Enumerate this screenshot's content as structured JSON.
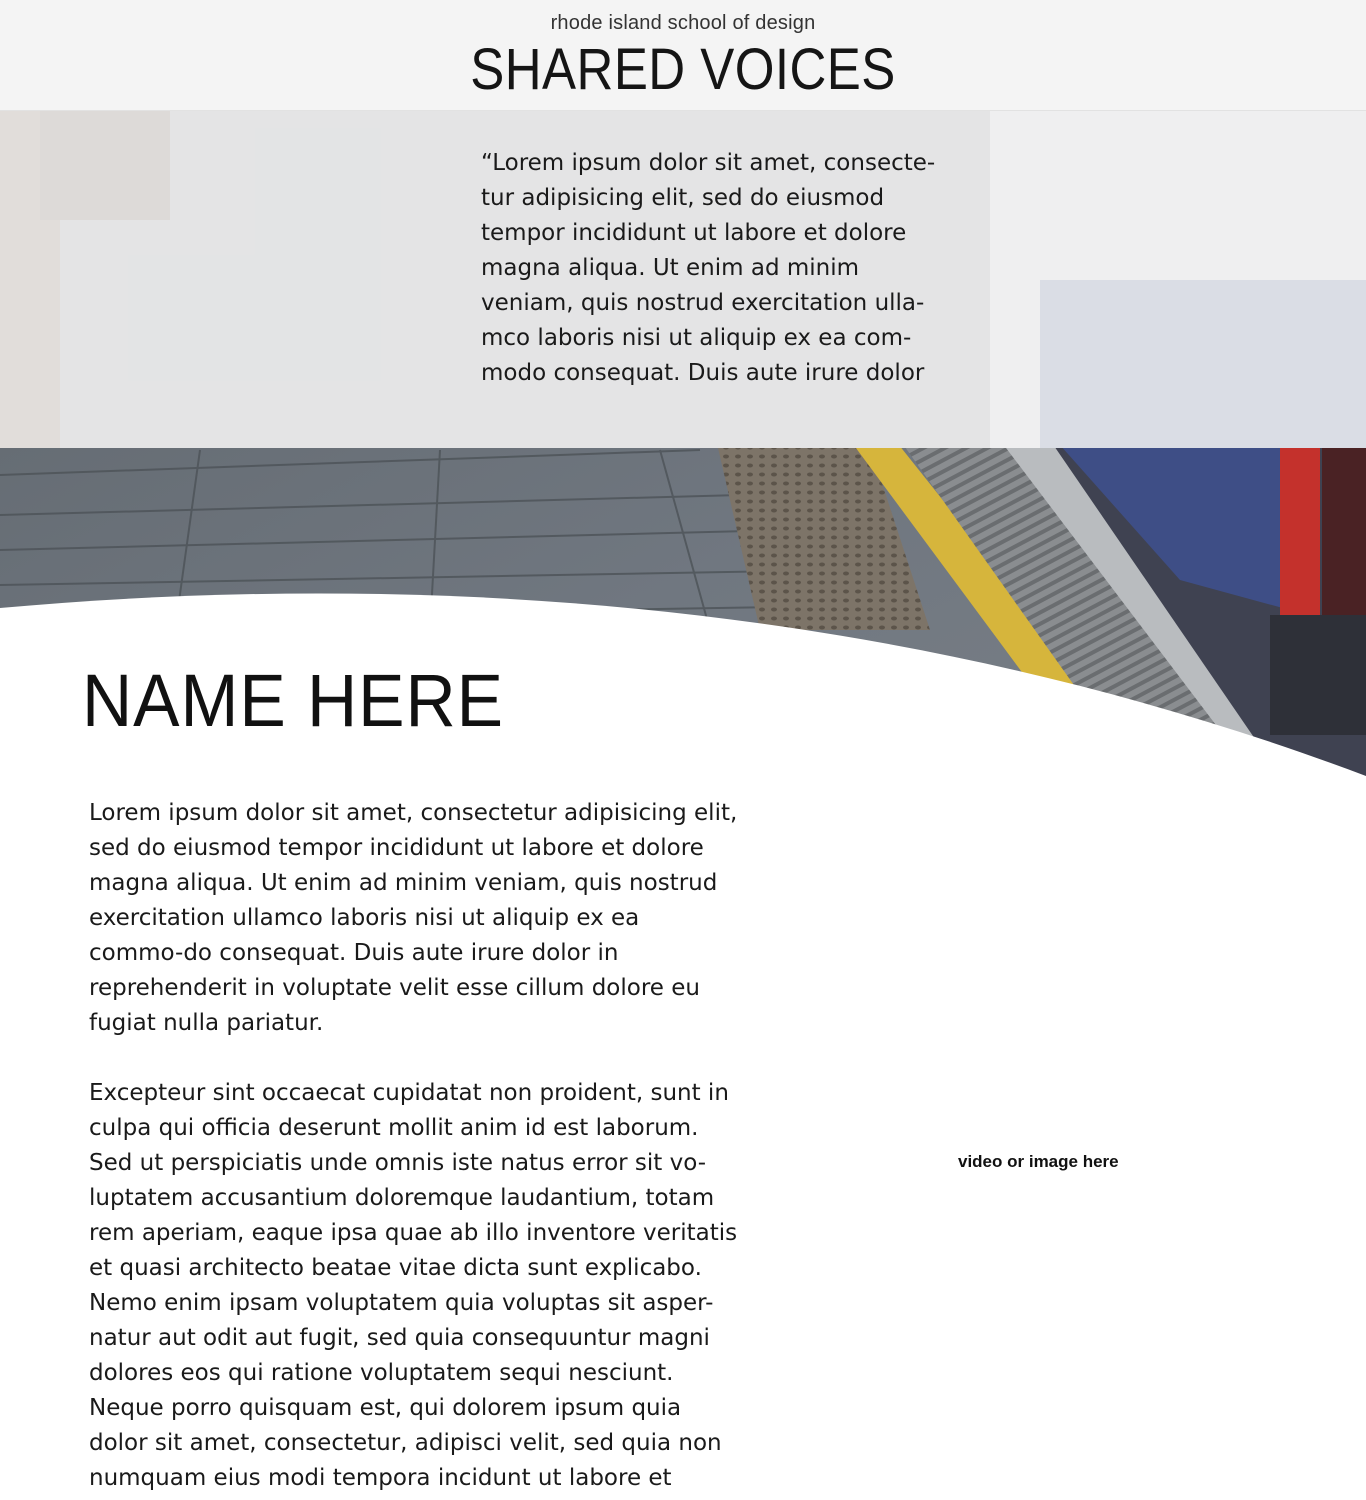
{
  "header": {
    "subtitle": "rhode island school of design",
    "title": "SHARED VOICES"
  },
  "hero": {
    "image": "train-platform-photo",
    "quote": "“Lorem ipsum dolor sit amet, consecte-tur adipisicing elit, sed do eiusmod tempor incididunt ut labore et dolore magna aliqua. Ut enim ad minim veniam, quis nostrud exercitation ulla-mco laboris nisi ut aliquip ex ea com-modo consequat. Duis aute irure dolor"
  },
  "profile": {
    "name": "NAME HERE",
    "paragraphs": [
      "Lorem ipsum dolor sit amet, consectetur adipisicing elit, sed do eiusmod tempor incididunt ut labore et dolore magna aliqua. Ut enim ad minim veniam, quis nostrud exercitation ullamco laboris nisi ut aliquip ex ea commo-do consequat. Duis aute irure dolor in reprehenderit in voluptate velit esse cillum dolore eu fugiat nulla pariatur.",
      "Excepteur sint occaecat cupidatat non proident, sunt in culpa qui officia deserunt mollit anim id est laborum. Sed ut perspiciatis unde omnis iste natus error sit vo-luptatem accusantium doloremque laudantium, totam rem aperiam, eaque ipsa quae ab illo inventore veritatis et quasi architecto beatae vitae dicta sunt explicabo. Nemo enim ipsam voluptatem quia voluptas sit asper-natur aut odit aut fugit, sed quia consequuntur magni dolores eos qui ratione voluptatem sequi nesciunt. Neque porro quisquam est, qui dolorem ipsum quia dolor sit amet, consectetur, adipisci velit, sed quia non numquam eius modi tempora incidunt ut labore et dolore magnam aliquam quaerat voluptatem."
    ]
  },
  "media": {
    "placeholder": "video or image here"
  },
  "colors": {
    "header_bg": "#f4f4f4",
    "platform_grey": "#6d7378",
    "tactile_yellow": "#d6b53c",
    "train_blue": "#3e4e86",
    "train_red": "#c4312c"
  }
}
